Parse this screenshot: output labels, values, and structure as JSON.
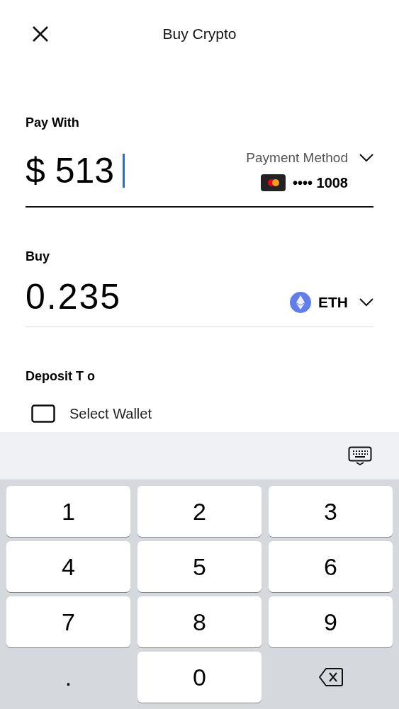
{
  "header": {
    "title": "Buy Crypto"
  },
  "pay_with": {
    "label": "Pay With",
    "currency_symbol": "$",
    "amount": "513",
    "method_label": "Payment Method",
    "card_mask": "•••• 1008"
  },
  "buy": {
    "label": "Buy",
    "amount": "0.235",
    "asset": "ETH"
  },
  "deposit_to": {
    "label": "Deposit T o",
    "wallet": "Select Wallet"
  },
  "keypad": {
    "keys": [
      {
        "kind": "digit",
        "label": "1"
      },
      {
        "kind": "digit",
        "label": "2"
      },
      {
        "kind": "digit",
        "label": "3"
      },
      {
        "kind": "digit",
        "label": "4"
      },
      {
        "kind": "digit",
        "label": "5"
      },
      {
        "kind": "digit",
        "label": "6"
      },
      {
        "kind": "digit",
        "label": "7"
      },
      {
        "kind": "digit",
        "label": "8"
      },
      {
        "kind": "digit",
        "label": "9"
      },
      {
        "kind": "plain",
        "label": "."
      },
      {
        "kind": "digit",
        "label": "0"
      },
      {
        "kind": "backspace"
      }
    ]
  }
}
